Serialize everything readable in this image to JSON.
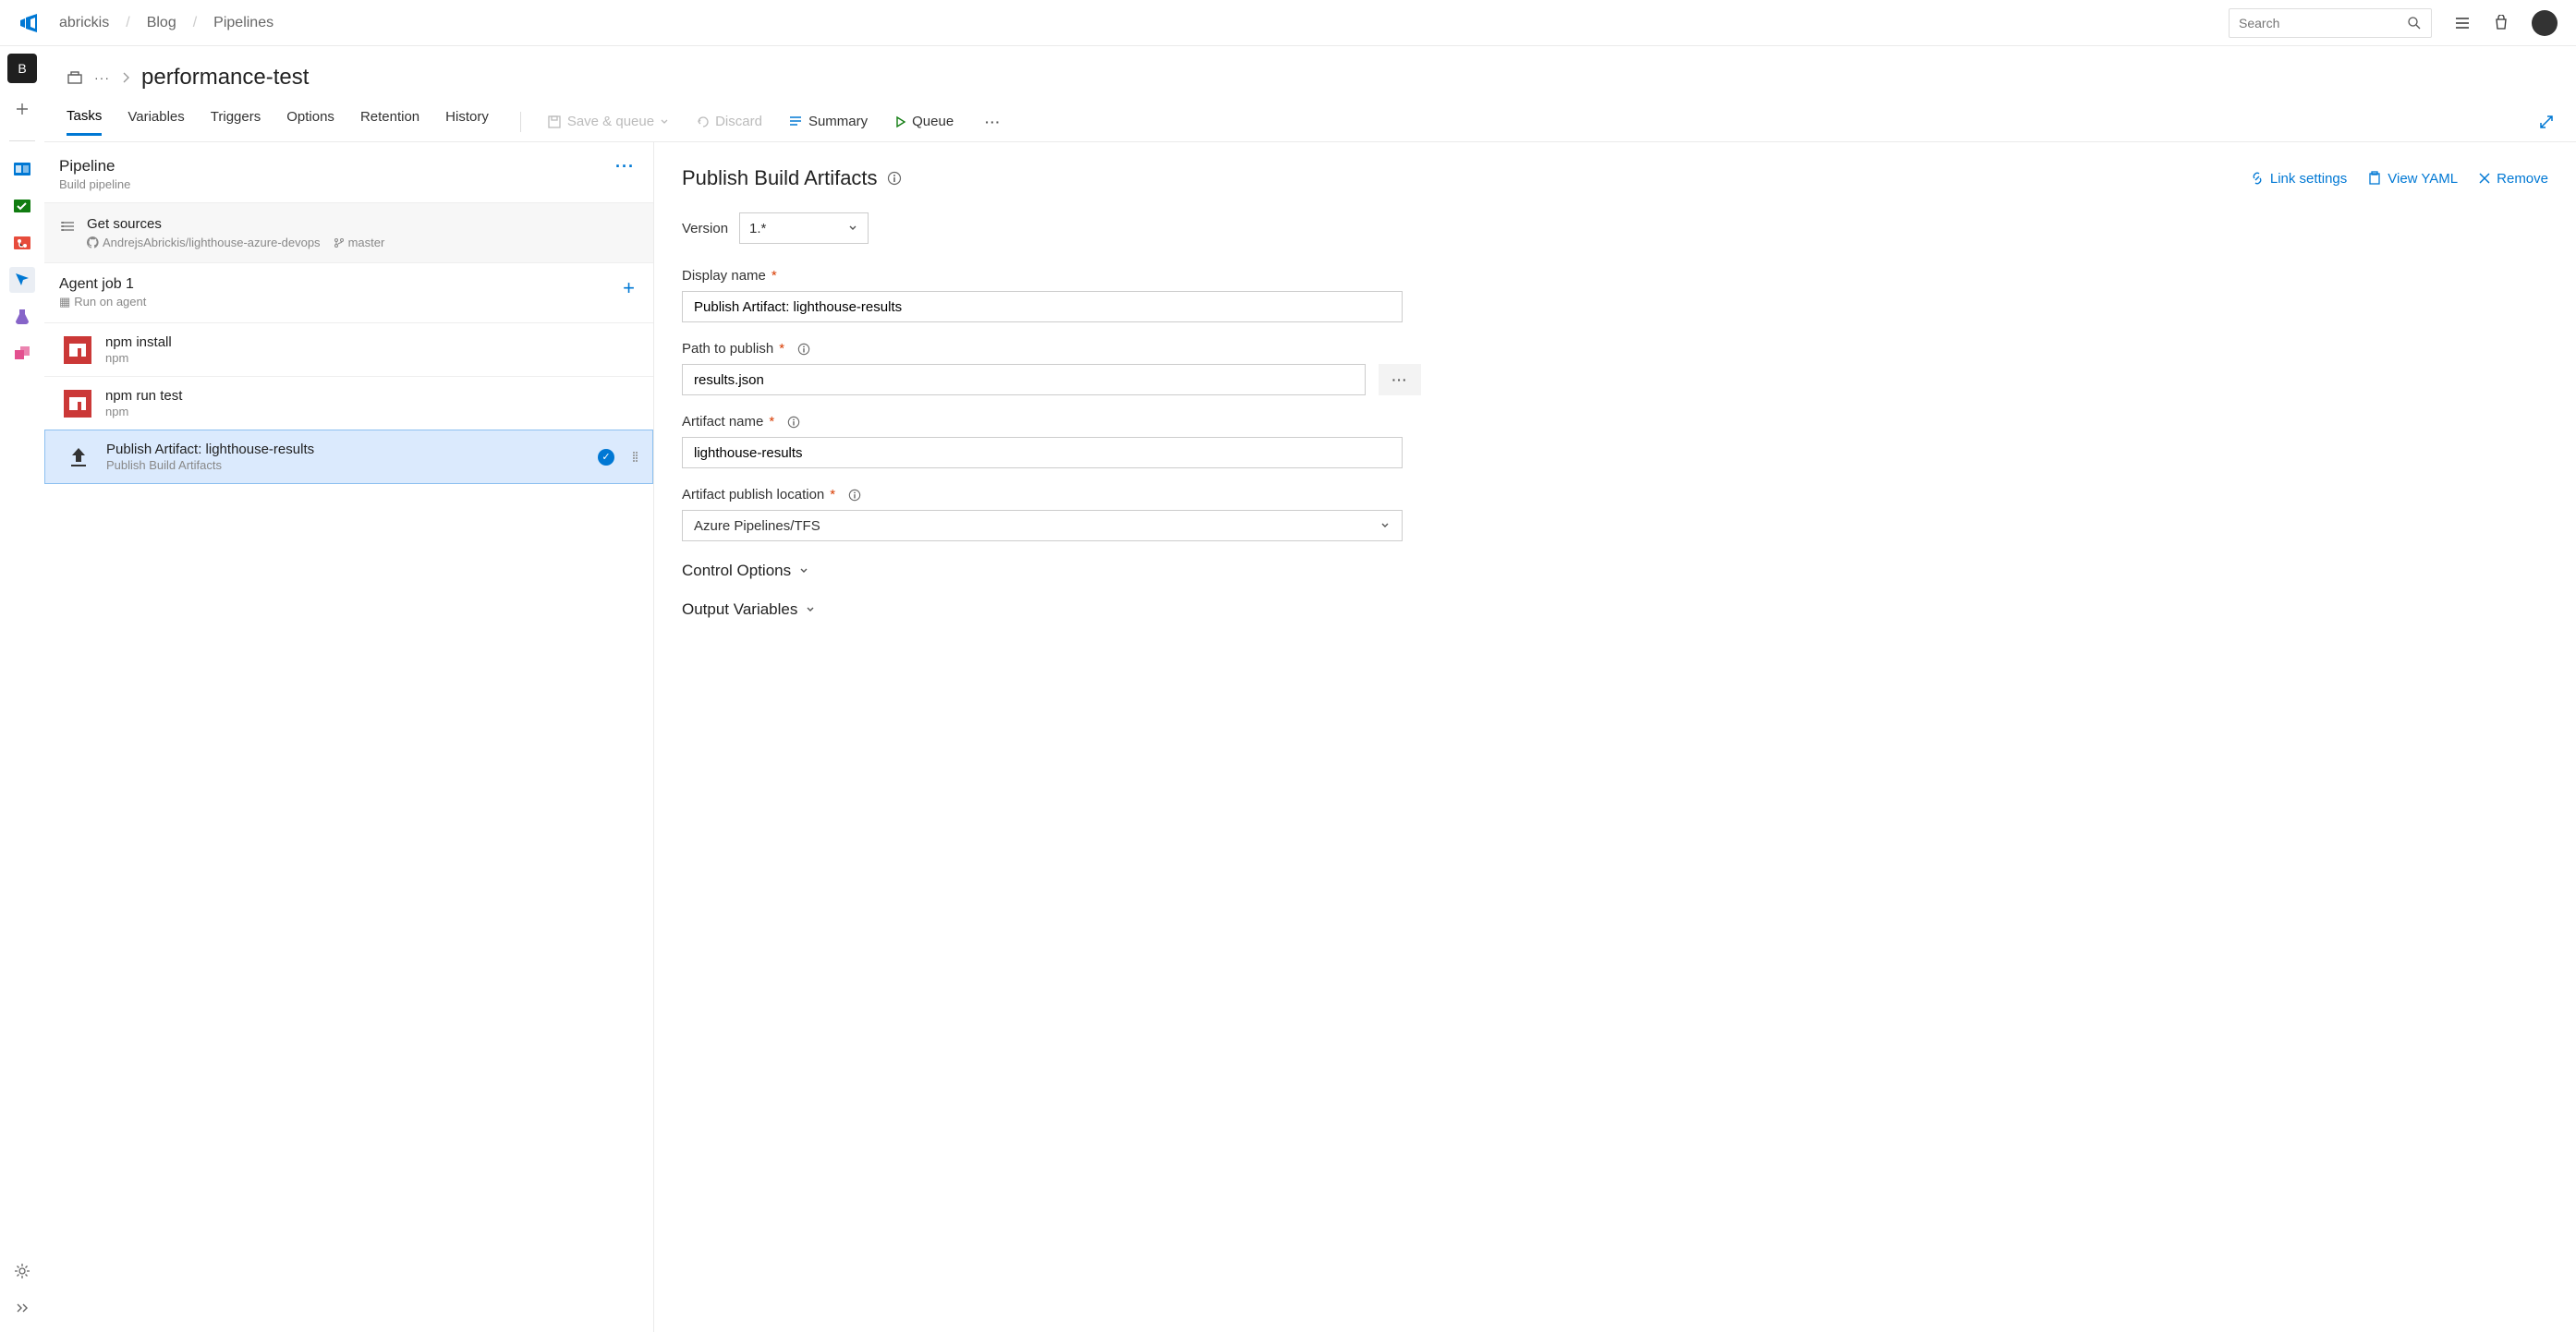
{
  "header": {
    "search_placeholder": "Search",
    "breadcrumbs": [
      "abrickis",
      "Blog",
      "Pipelines"
    ]
  },
  "rail": {
    "project_initial": "B"
  },
  "page": {
    "title": "performance-test",
    "tabs": [
      "Tasks",
      "Variables",
      "Triggers",
      "Options",
      "Retention",
      "History"
    ],
    "actions": {
      "save_queue": "Save & queue",
      "discard": "Discard",
      "summary": "Summary",
      "queue": "Queue"
    }
  },
  "pipeline": {
    "title": "Pipeline",
    "subtitle": "Build pipeline",
    "get_sources": {
      "title": "Get sources",
      "repo": "AndrejsAbrickis/lighthouse-azure-devops",
      "branch": "master"
    },
    "agent_job": {
      "title": "Agent job 1",
      "subtitle": "Run on agent"
    },
    "tasks": [
      {
        "title": "npm install",
        "subtitle": "npm",
        "icon": "npm"
      },
      {
        "title": "npm run test",
        "subtitle": "npm",
        "icon": "npm"
      },
      {
        "title": "Publish Artifact: lighthouse-results",
        "subtitle": "Publish Build Artifacts",
        "icon": "upload",
        "selected": true
      }
    ]
  },
  "details": {
    "title": "Publish Build Artifacts",
    "links": {
      "link_settings": "Link settings",
      "view_yaml": "View YAML",
      "remove": "Remove"
    },
    "version_label": "Version",
    "version_value": "1.*",
    "display_name_label": "Display name",
    "display_name_value": "Publish Artifact: lighthouse-results",
    "path_label": "Path to publish",
    "path_value": "results.json",
    "artifact_name_label": "Artifact name",
    "artifact_name_value": "lighthouse-results",
    "publish_loc_label": "Artifact publish location",
    "publish_loc_value": "Azure Pipelines/TFS",
    "control_options": "Control Options",
    "output_variables": "Output Variables"
  }
}
